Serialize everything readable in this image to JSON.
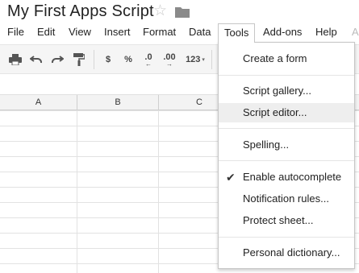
{
  "document": {
    "title": "My First Apps Script"
  },
  "menubar": {
    "items": [
      "File",
      "Edit",
      "View",
      "Insert",
      "Format",
      "Data",
      "Tools",
      "Add-ons",
      "Help"
    ],
    "active": "Tools",
    "overflow_text": "A"
  },
  "toolbar": {
    "print_icon": "print-icon",
    "undo_icon": "undo-icon",
    "redo_icon": "redo-icon",
    "paint_format_icon": "paint-format-icon",
    "currency_label": "$",
    "percent_label": "%",
    "decrease_decimal_label": ".0",
    "increase_decimal_label": ".00",
    "more_formats_label": "123"
  },
  "grid": {
    "columns": [
      "A",
      "B",
      "C"
    ]
  },
  "tools_menu": {
    "items": [
      {
        "label": "Create a form"
      },
      {
        "label": "Script gallery..."
      },
      {
        "label": "Script editor...",
        "highlighted": true
      },
      {
        "label": "Spelling..."
      },
      {
        "label": "Enable autocomplete",
        "checked": true
      },
      {
        "label": "Notification rules..."
      },
      {
        "label": "Protect sheet..."
      },
      {
        "label": "Personal dictionary..."
      }
    ]
  }
}
